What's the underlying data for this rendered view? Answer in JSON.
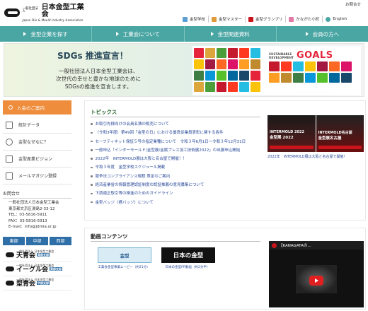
{
  "header": {
    "logo_small": "一般社団法人",
    "logo_main": "日本金型工業会",
    "logo_sub": "Japan Die & Mould Industry Association",
    "inquiry": "お問合せ"
  },
  "util_nav": [
    {
      "label": "金型学校",
      "icon": "school-icon",
      "color": "#5aa0d6"
    },
    {
      "label": "金型マスター",
      "icon": "master-icon",
      "color": "#e09a3a"
    },
    {
      "label": "金型グランプリ",
      "icon": "trophy-icon",
      "color": "#c9141b"
    },
    {
      "label": "かながた小町",
      "icon": "komachi-icon",
      "color": "#e27aa6"
    },
    {
      "label": "English",
      "icon": "globe-icon",
      "color": "#4aa6a3"
    }
  ],
  "main_nav": [
    {
      "label": "金型企業を探す"
    },
    {
      "label": "工業会について"
    },
    {
      "label": "金型関連資料"
    },
    {
      "label": "会員の方へ"
    }
  ],
  "hero": {
    "title": "SDGs 推進宣言！",
    "body": [
      "一般社団法人日本金型工業会は、",
      "次世代の幸せと豊かな地球のために",
      "SDGsの推進を宣言します。"
    ],
    "sdg_small_1": "SUSTAINABLE",
    "sdg_small_2": "DEVELOPMENT",
    "sdg_goals": "GOALS",
    "sdg_colors": [
      "#e5243b",
      "#dda63a",
      "#4c9f38",
      "#c5192d",
      "#ff3a21",
      "#26bde2",
      "#fcc30b",
      "#a21942",
      "#fd6925",
      "#dd1367",
      "#fd9d24",
      "#bf8b2e",
      "#3f7e44",
      "#0a97d9",
      "#56c02b",
      "#00689d",
      "#19486a"
    ]
  },
  "sidebar": {
    "join_label": "入会のご案内",
    "links": [
      {
        "label": "統計データ",
        "icon": "chart-icon"
      },
      {
        "label": "金型なぜなに？",
        "icon": "question-icon"
      },
      {
        "label": "金型産業ビジョン",
        "icon": "vision-icon"
      },
      {
        "label": "メールマガジン登録",
        "icon": "mail-icon"
      }
    ],
    "contact_head": "お問合せ",
    "contact_lines": [
      "一般社団法人日本金型工業会",
      "東京都文京区湯島2-33-12",
      "TEL：03-5816-5911",
      "FAX：03-5816-5913",
      "E-mail：info@jdmia.or.jp"
    ],
    "regions": [
      "東部",
      "中部",
      "西部"
    ],
    "branches": [
      {
        "small": "一般社団法人 日本金型工業会",
        "name": "天青会",
        "badge": "東部支部"
      },
      {
        "small": "一般社団法人 日本金型工業会",
        "name": "イーグル会",
        "badge": "東部支部"
      },
      {
        "small": "一般社団法人 日本金型工業会",
        "name": "型青会",
        "badge": "中部支部"
      }
    ]
  },
  "topics": {
    "heading": "トピックス",
    "items": [
      "お取引先様向けの会員名簿の販売について",
      "（令和3年度）第49回「金型の日」における優良従業員表彰に関する各件",
      "セーフティネット保証５号の指定業種について　令和３年6月1日～令和３年12月31日",
      "一般申込「インターモールド/金型展/金属プレス加工技術展2022」の出展申込開始",
      "2022年　INTERMOLD展は大阪と名古屋で開催！！",
      "令和３年度　金型学校スケジュール掲載",
      "競争法コンプライアンス規程 策定のご案内",
      "経済産業省の情報管理認証制度の認証推薦の意見募集について",
      "下請適正取引等の推進のためのガイドライン",
      "金型バッジ（襟バッジ）について"
    ],
    "banner_left_1": "INTERMOLD 2022",
    "banner_left_2": "金型展 2022",
    "banner_right_1": "INTERMOLD名古屋",
    "banner_right_2": "金型展名古屋",
    "banner_caption": "2022年　INTERMOLD展は大阪と名古屋で開催！"
  },
  "video": {
    "heading": "動画コンテンツ",
    "thumb1": "金型",
    "thumb1_cap": "工業会金型事業ムービー（約21分）",
    "thumb2": "日本の金型",
    "thumb2_cap": "日本の金型PR動画（約2分半）",
    "player_title": "【KANAGATAの…"
  }
}
